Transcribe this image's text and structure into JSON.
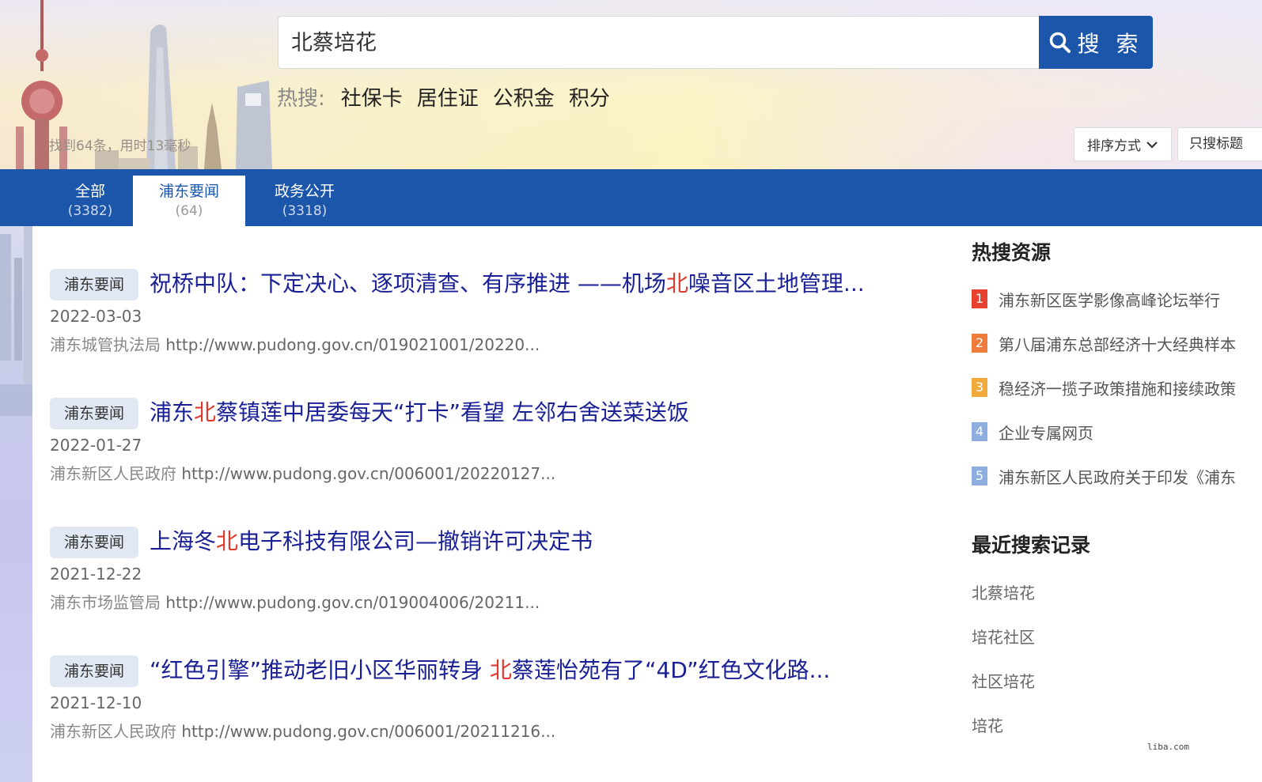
{
  "search": {
    "query": "北蔡培花",
    "button_label": "搜 索"
  },
  "hot_searches": {
    "label": "热搜:",
    "items": [
      "社保卡",
      "居住证",
      "公积金",
      "积分"
    ]
  },
  "result_count": "找到64条，用时13毫秒",
  "toolbar": {
    "sort_label": "排序方式",
    "title_only_label": "只搜标题"
  },
  "tabs": [
    {
      "label": "全部",
      "count": "(3382)"
    },
    {
      "label": "浦东要闻",
      "count": "(64)"
    },
    {
      "label": "政务公开",
      "count": "(3318)"
    }
  ],
  "results": [
    {
      "tag": "浦东要闻",
      "title_before": "祝桥中队：下定决心、逐项清查、有序推进 ——机场",
      "title_hl": "北",
      "title_after": "噪音区土地管理...",
      "date": "2022-03-03",
      "source": "浦东城管执法局",
      "url": "http://www.pudong.gov.cn/019021001/20220..."
    },
    {
      "tag": "浦东要闻",
      "title_before": "浦东",
      "title_hl": "北",
      "title_after": "蔡镇莲中居委每天“打卡”看望 左邻右舍送菜送饭",
      "date": "2022-01-27",
      "source": "浦东新区人民政府",
      "url": "http://www.pudong.gov.cn/006001/20220127..."
    },
    {
      "tag": "浦东要闻",
      "title_before": "上海冬",
      "title_hl": "北",
      "title_after": "电子科技有限公司—撤销许可决定书",
      "date": "2021-12-22",
      "source": "浦东市场监管局",
      "url": "http://www.pudong.gov.cn/019004006/20211..."
    },
    {
      "tag": "浦东要闻",
      "title_before": "“红色引擎”推动老旧小区华丽转身 ",
      "title_hl": "北",
      "title_after": "蔡莲怡苑有了“4D”红色文化路...",
      "date": "2021-12-10",
      "source": "浦东新区人民政府",
      "url": "http://www.pudong.gov.cn/006001/20211216..."
    }
  ],
  "sidebar": {
    "hot_title": "热搜资源",
    "hot_items": [
      {
        "rank": "1",
        "label": "浦东新区医学影像高峰论坛举行",
        "color": "#e8412f"
      },
      {
        "rank": "2",
        "label": "第八届浦东总部经济十大经典样本",
        "color": "#f07b3a"
      },
      {
        "rank": "3",
        "label": "稳经济一揽子政策措施和接续政策",
        "color": "#f2a93b"
      },
      {
        "rank": "4",
        "label": "企业专属网页",
        "color": "#8eaee0"
      },
      {
        "rank": "5",
        "label": "浦东新区人民政府关于印发《浦东",
        "color": "#8eaee0"
      }
    ],
    "recent_title": "最近搜索记录",
    "recent_items": [
      "北蔡培花",
      "培花社区",
      "社区培花",
      "培花"
    ]
  },
  "watermark": "liba.com",
  "colors": {
    "brand_blue": "#1c56ab",
    "title_link": "#1a2196",
    "highlight": "#e03a2e"
  }
}
